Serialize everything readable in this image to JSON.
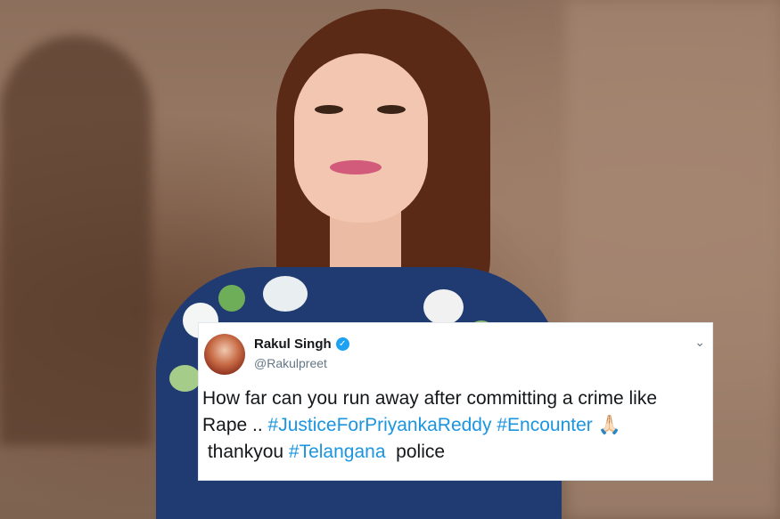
{
  "tweet": {
    "name": "Rakul Singh",
    "handle": "@Rakulpreet",
    "line1": "How far can you run away after committing a crime like",
    "line2_prefix": "Rape .. ",
    "tag1": "#JusticeForPriyankaReddy",
    "tag2": "#Encounter",
    "emoji": "🙏🏻",
    "line3_prefix": " thankyou ",
    "tag3": "#Telangana",
    "line3_suffix": "  police",
    "verified_icon": "✓",
    "chevron_icon": "⌄"
  },
  "colors": {
    "link": "#1b95e0",
    "verified": "#1da1f2"
  }
}
